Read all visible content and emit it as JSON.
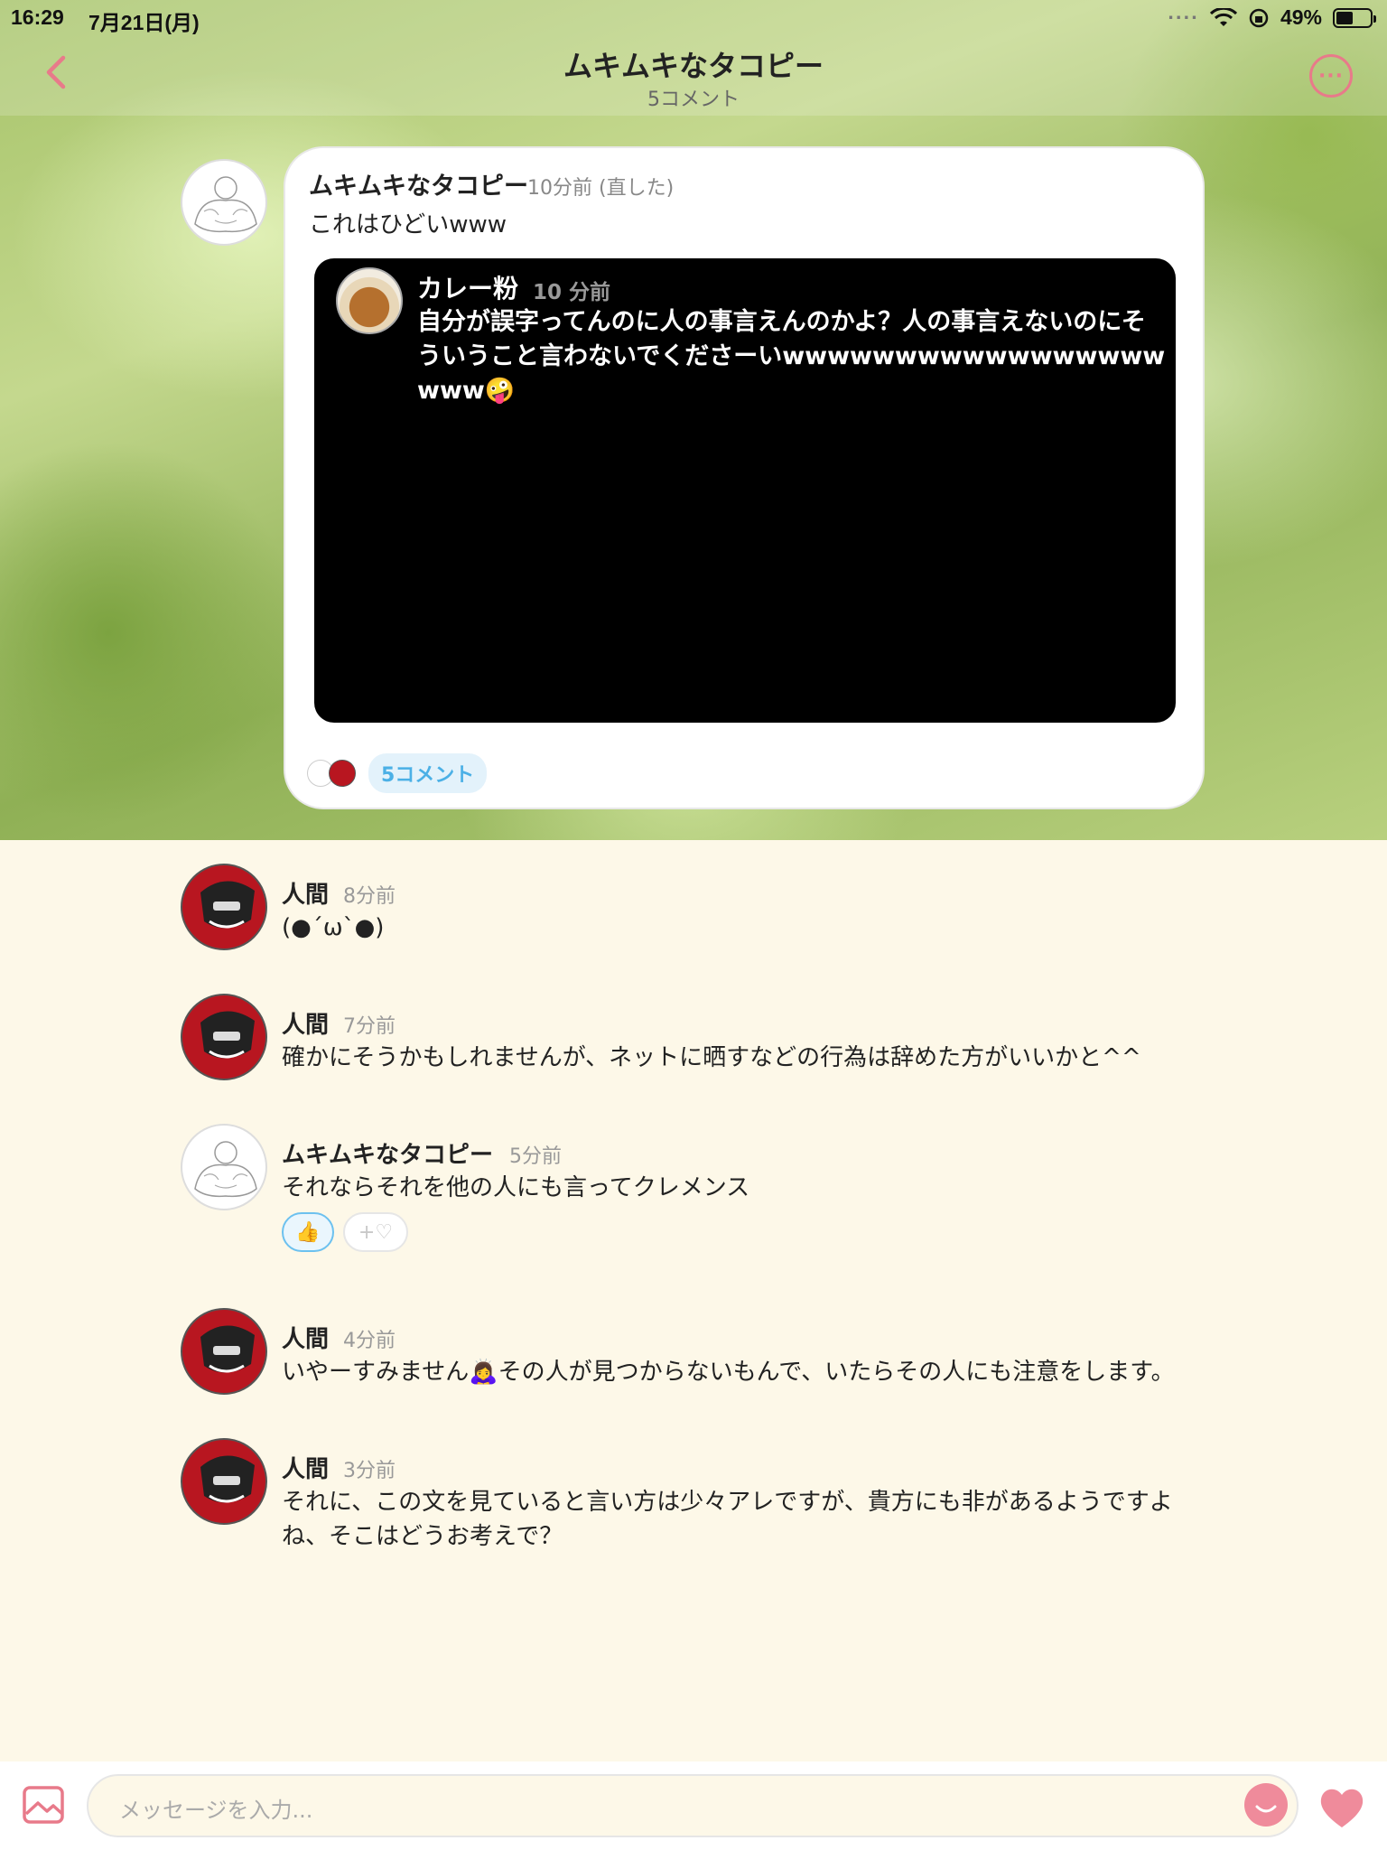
{
  "status_bar": {
    "time": "16:29",
    "date": "7月21日(月)",
    "battery": "49%",
    "battery_level": 0.49
  },
  "nav": {
    "title": "ムキムキなタコピー",
    "subtitle": "5コメント"
  },
  "post": {
    "author": "ムキムキなタコピー",
    "meta": "10分前 (直した)",
    "text": "これはひどいwww",
    "quoted": {
      "author": "カレー粉",
      "time": "10 分前",
      "text": "自分が誤字ってんのに人の事言えんのかよ？人の事言えないのにそういうこと言わないでくださーいwwwwwwwwwwwwwwwwwwww🤪"
    },
    "comment_count_label": "5コメント"
  },
  "comments": [
    {
      "author": "人間",
      "time": "8分前",
      "text": "(●´ω`●)"
    },
    {
      "author": "人間",
      "time": "7分前",
      "text": "確かにそうかもしれませんが、ネットに晒すなどの行為は辞めた方がいいかと^^"
    },
    {
      "author": "ムキムキなタコピー",
      "time": "5分前",
      "text": "それならそれを他の人にも言ってクレメンス",
      "reaction": "👍",
      "add_reaction": "+♡"
    },
    {
      "author": "人間",
      "time": "4分前",
      "text": "いやーすみません🙇‍♀️その人が見つからないもんで、いたらその人にも注意をします。"
    },
    {
      "author": "人間",
      "time": "3分前",
      "text": "それに、この文を見ていると言い方は少々アレですが、貴方にも非があるようですよね、そこはどうお考えで？"
    }
  ],
  "input": {
    "placeholder": "メッセージを入力..."
  },
  "colors": {
    "accent": "#e87a8a",
    "link": "#4bb0e6",
    "background": "#fdf8e8"
  },
  "icons": [
    "back-chevron-icon",
    "more-icon",
    "image-icon",
    "emoji-icon",
    "heart-icon"
  ]
}
